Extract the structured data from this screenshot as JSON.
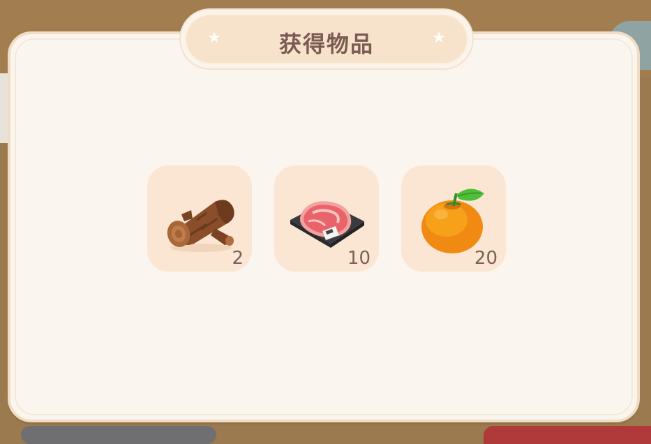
{
  "dialog": {
    "title": "获得物品"
  },
  "items": [
    {
      "name": "wood-log-icon",
      "count": "2"
    },
    {
      "name": "steak-icon",
      "count": "10"
    },
    {
      "name": "orange-icon",
      "count": "20"
    }
  ],
  "colors": {
    "panel": "#faf6ef",
    "slot": "#fbe6d3",
    "title_text": "#7a5a52",
    "count_text": "#7d6156"
  }
}
